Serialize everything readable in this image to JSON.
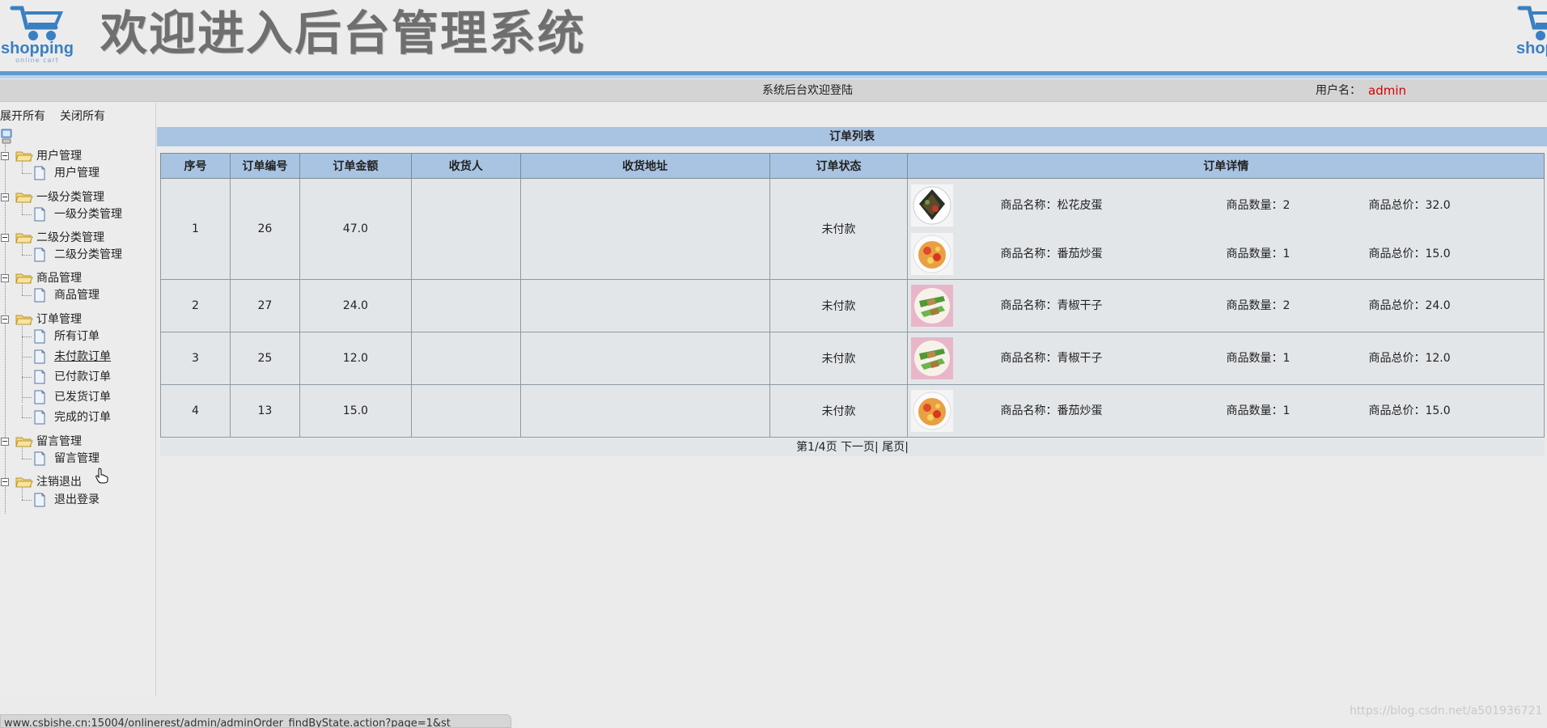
{
  "header": {
    "logo_text": "shopping",
    "logo_sub": "online cart",
    "title": "欢迎进入后台管理系统"
  },
  "statusbar": {
    "welcome": "系统后台欢迎登陆",
    "user_label": "用户名：",
    "user_name": "admin"
  },
  "sidebar": {
    "expand_all": "展开所有",
    "close_all": "关闭所有",
    "groups": [
      {
        "label": "用户管理",
        "children": [
          "用户管理"
        ]
      },
      {
        "label": "一级分类管理",
        "children": [
          "一级分类管理"
        ]
      },
      {
        "label": "二级分类管理",
        "children": [
          "二级分类管理"
        ]
      },
      {
        "label": "商品管理",
        "children": [
          "商品管理"
        ]
      },
      {
        "label": "订单管理",
        "children": [
          "所有订单",
          "未付款订单",
          "已付款订单",
          "已发货订单",
          "完成的订单"
        ]
      },
      {
        "label": "留言管理",
        "children": [
          "留言管理"
        ]
      },
      {
        "label": "注销退出",
        "children": [
          "退出登录"
        ]
      }
    ]
  },
  "main": {
    "title": "订单列表",
    "columns": [
      "序号",
      "订单编号",
      "订单金额",
      "收货人",
      "收货地址",
      "订单状态",
      "订单详情"
    ],
    "orders": [
      {
        "seq": "1",
        "order_no": "26",
        "amount": "47.0",
        "receiver": "",
        "address": "",
        "status": "未付款",
        "items": [
          {
            "name": "商品名称：松花皮蛋",
            "qty": "商品数量：2",
            "total": "商品总价：32.0",
            "thumb": "preserved-egg-dish"
          },
          {
            "name": "商品名称：番茄炒蛋",
            "qty": "商品数量：1",
            "total": "商品总价：15.0",
            "thumb": "tomato-egg-dish"
          }
        ]
      },
      {
        "seq": "2",
        "order_no": "27",
        "amount": "24.0",
        "receiver": "",
        "address": "",
        "status": "未付款",
        "items": [
          {
            "name": "商品名称：青椒干子",
            "qty": "商品数量：2",
            "total": "商品总价：24.0",
            "thumb": "pepper-tofu-dish"
          }
        ]
      },
      {
        "seq": "3",
        "order_no": "25",
        "amount": "12.0",
        "receiver": "",
        "address": "",
        "status": "未付款",
        "items": [
          {
            "name": "商品名称：青椒干子",
            "qty": "商品数量：1",
            "total": "商品总价：12.0",
            "thumb": "pepper-tofu-dish"
          }
        ]
      },
      {
        "seq": "4",
        "order_no": "13",
        "amount": "15.0",
        "receiver": "",
        "address": "",
        "status": "未付款",
        "items": [
          {
            "name": "商品名称：番茄炒蛋",
            "qty": "商品数量：1",
            "total": "商品总价：15.0",
            "thumb": "tomato-egg-dish"
          }
        ]
      }
    ],
    "pager": {
      "page_info": "第1/4页",
      "next": "下一页",
      "sep1": "|",
      "last": "尾页",
      "sep2": "|"
    }
  },
  "browser_status": {
    "url": "www.csbishe.cn:15004/onlinerest/admin/adminOrder_findByState.action?page=1&st"
  },
  "watermark": "https://blog.csdn.net/a501936721",
  "colors": {
    "header_blue": "#5b9bd5",
    "table_header": "#a9c4e2",
    "username_red": "#d40000"
  }
}
